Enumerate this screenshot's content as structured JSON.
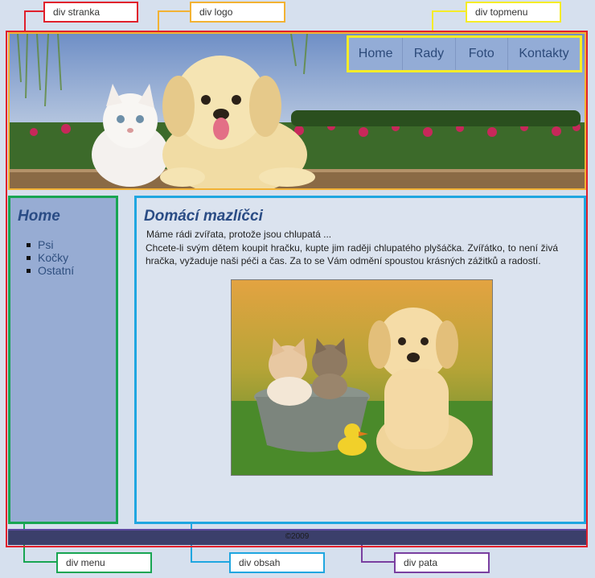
{
  "labels": {
    "stranka": "div stranka",
    "logo": "div logo",
    "topmenu": "div topmenu",
    "menu": "div menu",
    "obsah": "div obsah",
    "pata": "div pata"
  },
  "colors": {
    "stranka": "#e0202c",
    "logo": "#f2b233",
    "topmenu": "#f5ec28",
    "menu": "#18a552",
    "obsah": "#1fa6e0",
    "pata": "#7a3fa0"
  },
  "topmenu": {
    "items": [
      "Home",
      "Rady",
      "Foto",
      "Kontakty"
    ]
  },
  "sidebar": {
    "title": "Home",
    "items": [
      "Psi",
      "Kočky",
      "Ostatní"
    ]
  },
  "content": {
    "title": "Domácí mazlíčci",
    "intro": "Máme rádi zvířata, protože jsou chlupatá ...",
    "body": "Chcete-li svým  dětem koupit hračku, kupte  jim raději chlupatého plyšáčka. Zvířátko, to  není živá  hračka,  vyžaduje  naši  péči  a  čas.  Za  to  se  Vám  odmění  spoustou krásných zážitků a radostí."
  },
  "footer": {
    "text": "©2009"
  }
}
